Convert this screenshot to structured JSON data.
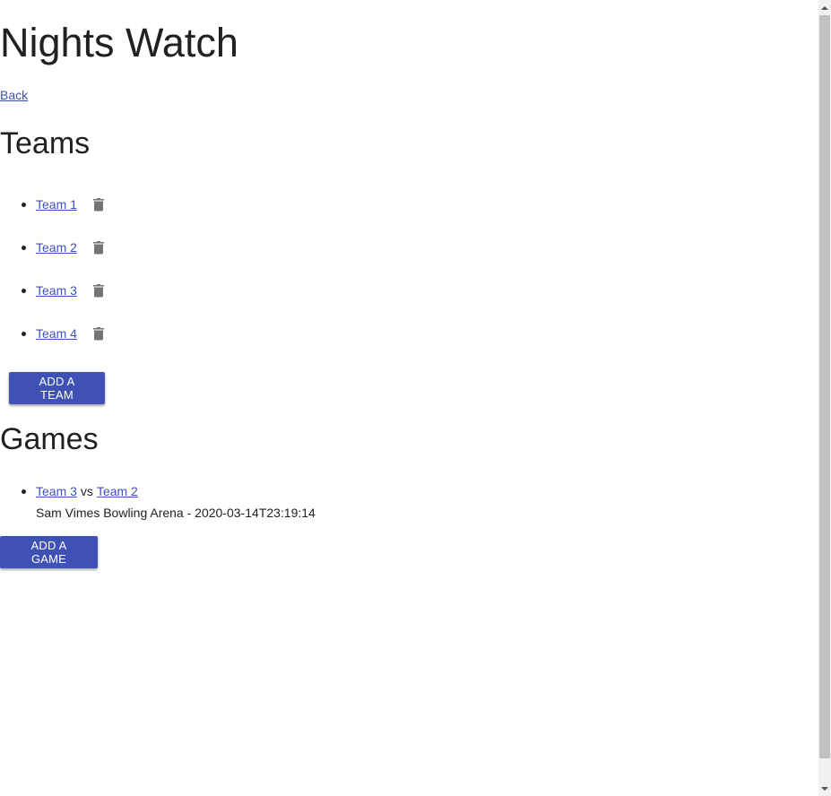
{
  "page": {
    "title": "Nights Watch",
    "back_label": "Back"
  },
  "teams": {
    "heading": "Teams",
    "items": [
      {
        "label": "Team 1"
      },
      {
        "label": "Team 2"
      },
      {
        "label": "Team 3"
      },
      {
        "label": "Team 4"
      }
    ],
    "add_button_label": "ADD A TEAM"
  },
  "games": {
    "heading": "Games",
    "items": [
      {
        "home_team": "Team 3",
        "vs_label": "vs",
        "away_team": "Team 2",
        "detail": "Sam Vimes Bowling Arena - 2020-03-14T23:19:14"
      }
    ],
    "add_button_label": "ADD A GAME"
  },
  "colors": {
    "accent": "#3f51b5",
    "icon": "#757575",
    "text": "#212121"
  },
  "icons": {
    "delete": "trash-icon"
  }
}
